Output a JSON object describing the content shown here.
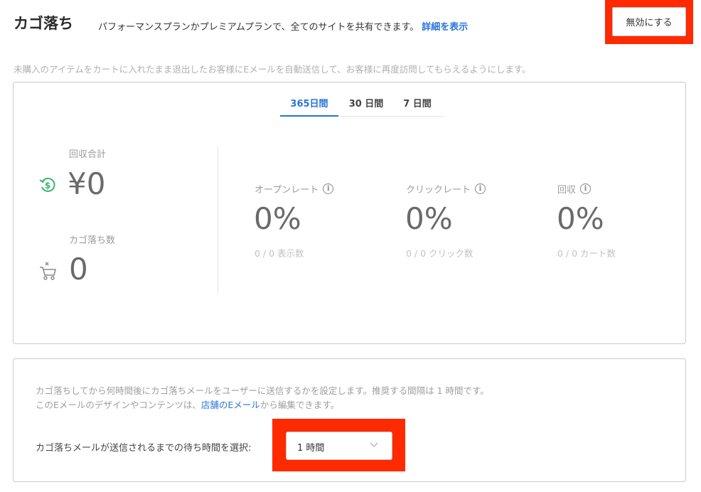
{
  "header": {
    "title": "カゴ落ち",
    "subtitle": "パフォーマンスプランかプレミアムプランで、全てのサイトを共有できます。",
    "details_link": "詳細を表示",
    "disable_button": "無効にする"
  },
  "description": "未購入のアイテムをカートに入れたまま退出したお客様にEメールを自動送信して、お客様に再度訪問してもらえるようにします。",
  "tabs": [
    {
      "label": "365日間",
      "active": true
    },
    {
      "label": "30 日間",
      "active": false
    },
    {
      "label": "7 日間",
      "active": false
    }
  ],
  "summary": {
    "recovered_label": "回収合計",
    "recovered_value": "¥0",
    "abandoned_label": "カゴ落ち数",
    "abandoned_value": "0"
  },
  "stats": [
    {
      "label": "オープンレート",
      "value": "0%",
      "sub": "0 / 0 表示数"
    },
    {
      "label": "クリックレート",
      "value": "0%",
      "sub": "0 / 0 クリック数"
    },
    {
      "label": "回収",
      "value": "0%",
      "sub": "0 / 0 カート数"
    }
  ],
  "settings": {
    "line1": "カゴ落ちしてから何時間後にカゴ落ちメールをユーザーに送信するかを設定します。推奨する間隔は 1 時間です。",
    "line2_prefix": "このEメールのデザインやコンテンツは、",
    "line2_link": "店舗のEメール",
    "line2_suffix": "から編集できます。",
    "select_label": "カゴ落ちメールが送信されるまでの待ち時間を選択:",
    "select_value": "1 時間"
  },
  "colors": {
    "accent": "#2a73d8",
    "highlight": "#ff2a00",
    "recovery_icon": "#3cb371"
  }
}
